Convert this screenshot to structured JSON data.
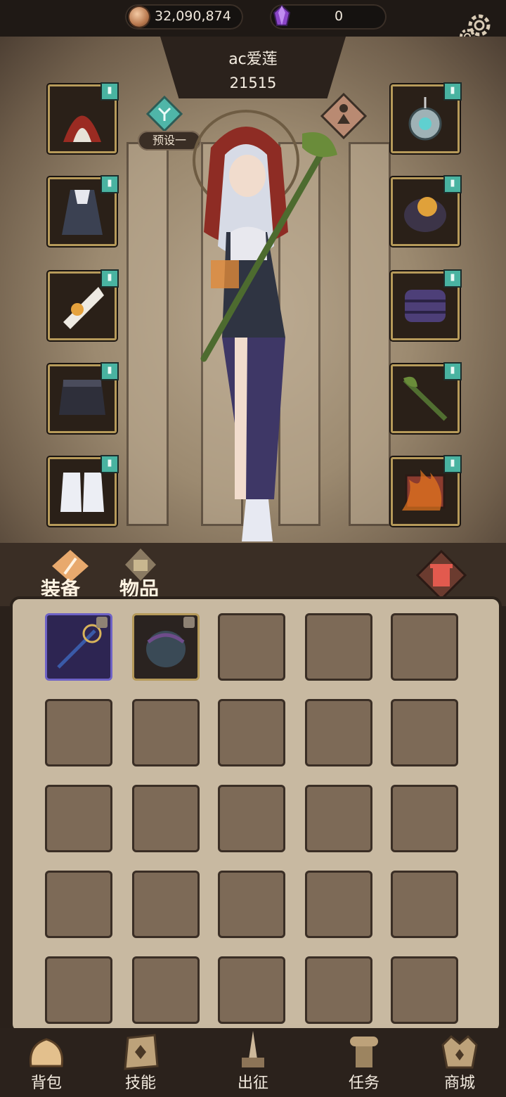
{
  "currency": {
    "coins": "32,090,874",
    "gems": "0"
  },
  "hero": {
    "name": "ac爱莲",
    "power": "21515",
    "preset_label": "预设一"
  },
  "equipment_slots": {
    "left": [
      "hood",
      "dress",
      "gloves",
      "skirt",
      "boots"
    ],
    "right": [
      "amulet",
      "ring",
      "bracers",
      "staff",
      "book"
    ]
  },
  "tabs": {
    "equipment": "装备",
    "items": "物品"
  },
  "inventory": {
    "columns": 5,
    "rows": 5
  },
  "nav": {
    "bag": "背包",
    "skills": "技能",
    "expedition": "出征",
    "quests": "任务",
    "shop": "商城"
  },
  "colors": {
    "slot_frame": "#b69a5a",
    "teal_tag": "#49b3a1",
    "rare_frame": "#6e62c6"
  }
}
